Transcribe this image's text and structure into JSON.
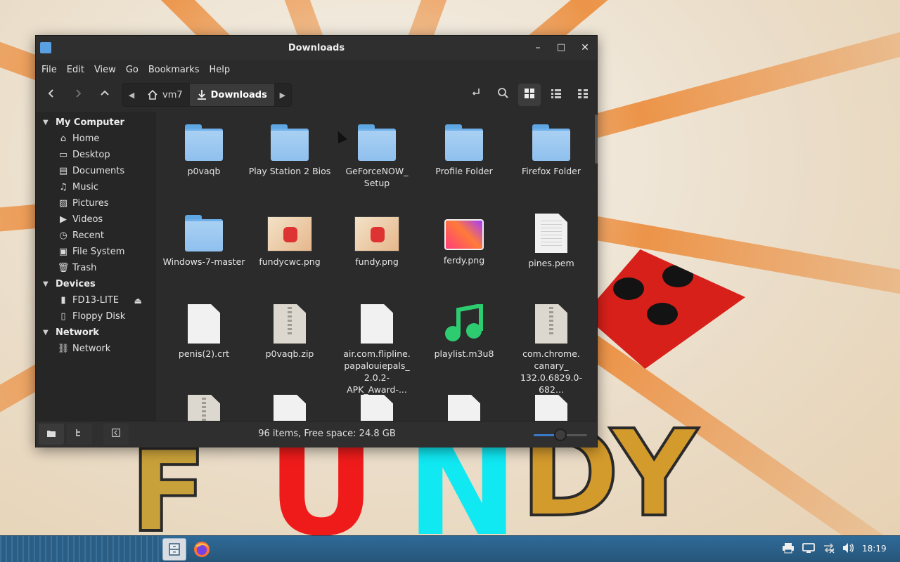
{
  "window": {
    "title": "Downloads",
    "controls": {
      "minimize": "–",
      "maximize": "□",
      "close": "✕"
    }
  },
  "menu": [
    "File",
    "Edit",
    "View",
    "Go",
    "Bookmarks",
    "Help"
  ],
  "breadcrumb": [
    "vm7",
    "Downloads"
  ],
  "sidebar": {
    "my_computer": {
      "heading": "My Computer",
      "items": [
        "Home",
        "Desktop",
        "Documents",
        "Music",
        "Pictures",
        "Videos",
        "Recent",
        "File System",
        "Trash"
      ]
    },
    "devices": {
      "heading": "Devices",
      "items": [
        "FD13-LITE",
        "Floppy Disk"
      ]
    },
    "network": {
      "heading": "Network",
      "items": [
        "Network"
      ]
    }
  },
  "files": [
    {
      "name": "p0vaqb",
      "kind": "folder"
    },
    {
      "name": "Play Station 2 Bios",
      "kind": "folder"
    },
    {
      "name": "GeForceNOW_ Setup",
      "kind": "folder"
    },
    {
      "name": "Profile Folder",
      "kind": "folder"
    },
    {
      "name": "Firefox Folder",
      "kind": "folder"
    },
    {
      "name": "Windows-7-master",
      "kind": "folder"
    },
    {
      "name": "fundycwc.png",
      "kind": "image-thumb"
    },
    {
      "name": "fundy.png",
      "kind": "image-thumb"
    },
    {
      "name": "ferdy.png",
      "kind": "image-gradient"
    },
    {
      "name": "pines.pem",
      "kind": "text"
    },
    {
      "name": "penis(2).crt",
      "kind": "doc"
    },
    {
      "name": "p0vaqb.zip",
      "kind": "zip"
    },
    {
      "name": "air.com.flipline. papalouiepals_ 2.0.2-APK_Award-...",
      "kind": "doc"
    },
    {
      "name": "playlist.m3u8",
      "kind": "audio"
    },
    {
      "name": "com.chrome. canary_ 132.0.6829.0-682...",
      "kind": "zip"
    },
    {
      "name": "",
      "kind": "zip"
    },
    {
      "name": "",
      "kind": "doc"
    },
    {
      "name": "",
      "kind": "doc"
    },
    {
      "name": "",
      "kind": "doc"
    },
    {
      "name": "",
      "kind": "doc"
    }
  ],
  "status": {
    "text": "96 items, Free space: 24.8 GB",
    "zoom_level": 0.5
  },
  "taskbar": {
    "clock": "18:19"
  },
  "wallpaper_text": [
    "F",
    "U",
    "N",
    "DY"
  ],
  "colors": {
    "accent": "#3a78c8",
    "folder": "#8fc0ee",
    "taskbar": "#2f6a98"
  }
}
